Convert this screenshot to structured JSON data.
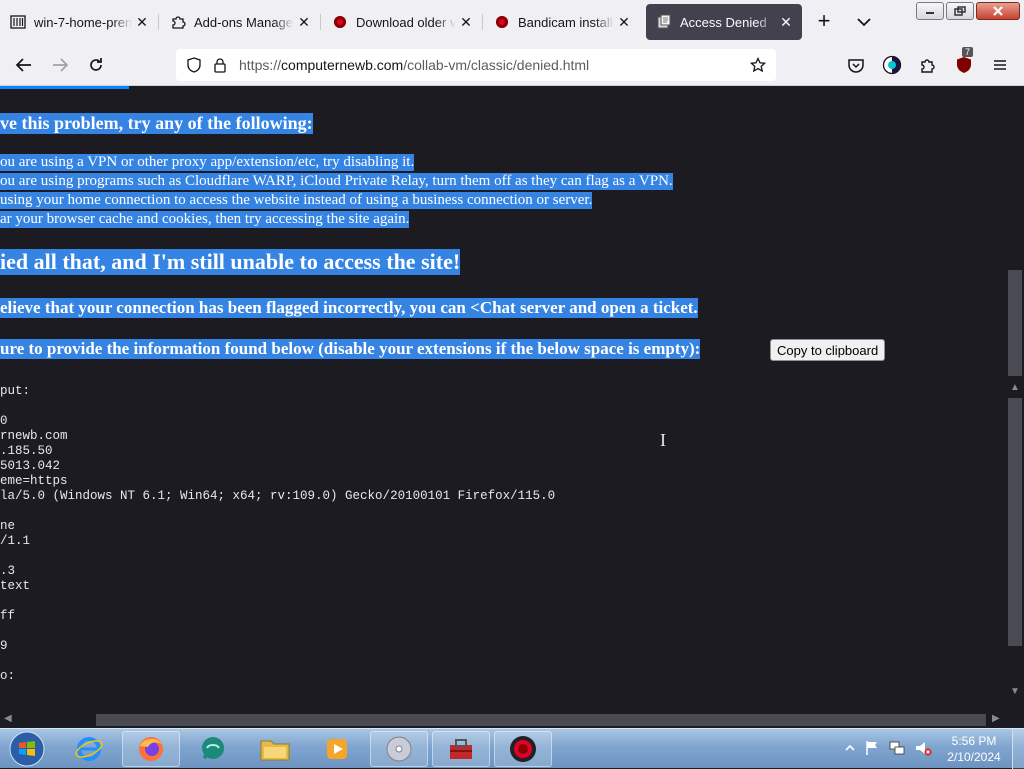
{
  "tabs": [
    {
      "label": "win-7-home-prem-",
      "icon": "document-icon",
      "active": false
    },
    {
      "label": "Add-ons Manager",
      "icon": "puzzle-icon",
      "active": false
    },
    {
      "label": "Download older ve",
      "icon": "record-icon",
      "active": false
    },
    {
      "label": "Bandicam installati",
      "icon": "record-icon",
      "active": false
    },
    {
      "label": "Access Denied",
      "icon": "page-icon",
      "active": true
    }
  ],
  "tab_close_glyph": "✕",
  "new_tab_glyph": "+",
  "url": {
    "prefix": "https://",
    "domain": "computernewb.com",
    "path": "/collab-vm/classic/denied.html"
  },
  "toolbar": {
    "extensions_badge": "7"
  },
  "page": {
    "h_problem": "ve this problem, try any of the following:",
    "items": [
      "ou are using a VPN or other proxy app/extension/etc, try disabling it.",
      "ou are using programs such as Cloudflare WARP, iCloud Private Relay, turn them off as they can flag as a VPN.",
      " using your home connection to access the website instead of using a business connection or server.",
      "ar your browser cache and cookies, then try accessing the site again."
    ],
    "h_tried": "ied all that, and I'm still unable to access the site!",
    "h_flagged": "elieve that your connection has been flagged incorrectly, you can <Chat server and open a ticket.",
    "h_provide": "ure to provide the information found below (disable your extensions if the below space is empty):",
    "copy_button": "Copy to clipboard",
    "output_lines": [
      "put:",
      "",
      "0",
      "rnewb.com",
      ".185.50",
      "5013.042",
      "eme=https",
      "la/5.0 (Windows NT 6.1; Win64; x64; rv:109.0) Gecko/20100101 Firefox/115.0",
      "",
      "ne",
      "/1.1",
      "",
      ".3",
      "text",
      "",
      "ff",
      "",
      "9",
      "",
      "o:"
    ]
  },
  "taskbar": {
    "apps": [
      "internet-explorer-icon",
      "firefox-icon",
      "chat-app-icon",
      "file-explorer-icon",
      "media-player-icon",
      "dvd-maker-icon",
      "toolbox-icon",
      "bandicam-icon"
    ],
    "time": "5:56 PM",
    "date": "2/10/2024"
  },
  "colors": {
    "selection": "#3584e4",
    "page_bg": "#1c1b22",
    "toolbar_bg": "#f0f0f4",
    "accent": "#0a84ff"
  }
}
